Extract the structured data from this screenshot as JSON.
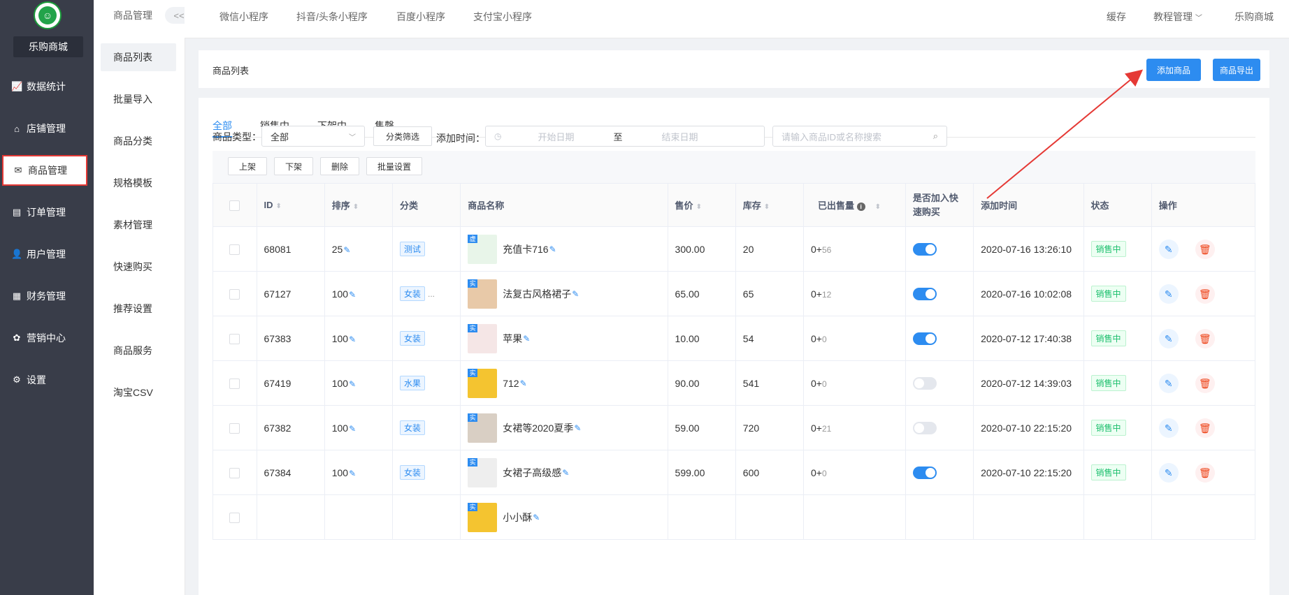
{
  "sidebar": {
    "shop_name": "乐购商城",
    "items": [
      {
        "label": "数据统计",
        "icon": "📈",
        "icon_name": "chart-line-icon"
      },
      {
        "label": "店铺管理",
        "icon": "⌂",
        "icon_name": "store-icon"
      },
      {
        "label": "商品管理",
        "icon": "✉",
        "icon_name": "goods-icon"
      },
      {
        "label": "订单管理",
        "icon": "▤",
        "icon_name": "order-icon"
      },
      {
        "label": "用户管理",
        "icon": "👤",
        "icon_name": "user-icon"
      },
      {
        "label": "财务管理",
        "icon": "▦",
        "icon_name": "finance-icon"
      },
      {
        "label": "营销中心",
        "icon": "✿",
        "icon_name": "marketing-icon"
      },
      {
        "label": "设置",
        "icon": "⚙",
        "icon_name": "settings-icon"
      }
    ]
  },
  "subnav": {
    "header": "商品管理",
    "collapse": "<<",
    "items": [
      "商品列表",
      "批量导入",
      "商品分类",
      "规格模板",
      "素材管理",
      "快速购买",
      "推荐设置",
      "商品服务",
      "淘宝CSV"
    ]
  },
  "topbar": {
    "tabs": [
      "微信小程序",
      "抖音/头条小程序",
      "百度小程序",
      "支付宝小程序"
    ],
    "right": {
      "cache": "缓存",
      "tutorial": "教程管理",
      "shop": "乐购商城"
    }
  },
  "header": {
    "title": "商品列表",
    "add_button": "添加商品",
    "export_button": "商品导出"
  },
  "status_tabs": [
    "全部",
    "销售中",
    "下架中",
    "售罄"
  ],
  "filters": {
    "type_label": "商品类型：",
    "type_value": "全部",
    "category_button": "分类筛选",
    "time_label": "添加时间：",
    "start_placeholder": "开始日期",
    "to": "至",
    "end_placeholder": "结束日期",
    "search_placeholder": "请输入商品ID或名称搜索"
  },
  "actions": [
    "上架",
    "下架",
    "删除",
    "批量设置"
  ],
  "table": {
    "headers": {
      "id": "ID",
      "sort": "排序",
      "category": "分类",
      "name": "商品名称",
      "price": "售价",
      "stock": "库存",
      "sold": "已出售量",
      "quick_buy_1": "是否加入快",
      "quick_buy_2": "速购买",
      "time": "添加时间",
      "status": "状态",
      "ops": "操作"
    },
    "rows": [
      {
        "id": "68081",
        "sort": "25",
        "category": "测试",
        "more": "",
        "name": "充值卡716",
        "price": "300.00",
        "stock": "20",
        "sold": "0+",
        "sold_extra": "56",
        "quick": true,
        "time": "2020-07-16 13:26:10",
        "status": "销售中",
        "thumb_color": "#e8f5e9",
        "thumb_badge": "虚"
      },
      {
        "id": "67127",
        "sort": "100",
        "category": "女装",
        "more": "...",
        "name": "法复古风格裙子",
        "price": "65.00",
        "stock": "65",
        "sold": "0+",
        "sold_extra": "12",
        "quick": true,
        "time": "2020-07-16 10:02:08",
        "status": "销售中",
        "thumb_color": "#e8c9a8",
        "thumb_badge": "实"
      },
      {
        "id": "67383",
        "sort": "100",
        "category": "女装",
        "more": "",
        "name": "苹果",
        "price": "10.00",
        "stock": "54",
        "sold": "0+",
        "sold_extra": "0",
        "quick": true,
        "time": "2020-07-12 17:40:38",
        "status": "销售中",
        "thumb_color": "#f5e6e6",
        "thumb_badge": "实"
      },
      {
        "id": "67419",
        "sort": "100",
        "category": "水果",
        "more": "",
        "name": "712",
        "price": "90.00",
        "stock": "541",
        "sold": "0+",
        "sold_extra": "0",
        "quick": false,
        "time": "2020-07-12 14:39:03",
        "status": "销售中",
        "thumb_color": "#f4c430",
        "thumb_badge": "实"
      },
      {
        "id": "67382",
        "sort": "100",
        "category": "女装",
        "more": "",
        "name": "女裙等2020夏季",
        "price": "59.00",
        "stock": "720",
        "sold": "0+",
        "sold_extra": "21",
        "quick": false,
        "time": "2020-07-10 22:15:20",
        "status": "销售中",
        "thumb_color": "#d9cfc4",
        "thumb_badge": "实"
      },
      {
        "id": "67384",
        "sort": "100",
        "category": "女装",
        "more": "",
        "name": "女裙子高级感",
        "price": "599.00",
        "stock": "600",
        "sold": "0+",
        "sold_extra": "0",
        "quick": true,
        "time": "2020-07-10 22:15:20",
        "status": "销售中",
        "thumb_color": "#eeeeee",
        "thumb_badge": "实"
      },
      {
        "id": "",
        "sort": "",
        "category": "",
        "more": "",
        "name": "小小酥",
        "price": "",
        "stock": "",
        "sold": "",
        "sold_extra": "",
        "quick": null,
        "time": "",
        "status": "",
        "thumb_color": "#f4c430",
        "thumb_badge": "实"
      }
    ]
  },
  "colors": {
    "primary": "#2d8cf0",
    "sidebar": "#393d49",
    "highlight": "#e53935",
    "success": "#19be6b",
    "danger": "#ed4014"
  }
}
